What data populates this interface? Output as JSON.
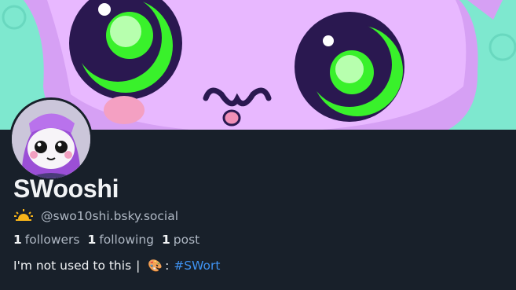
{
  "profile": {
    "display_name": "SWooshi",
    "handle_icon": "sunrise-icon",
    "handle": "@swo10shi.bsky.social",
    "stats": {
      "followers_count": "1",
      "followers_label": "followers",
      "following_count": "1",
      "following_label": "following",
      "posts_count": "1",
      "posts_label": "post"
    },
    "bio": {
      "text": "I'm not used to this",
      "separator": "|",
      "emoji": "🎨",
      "colon": ":",
      "hashtag": "#SWort"
    }
  },
  "colors": {
    "background": "#18202a",
    "banner_mint": "#7ee8cf",
    "banner_purple": "#c679ee",
    "eye_green": "#39f12b",
    "eye_navy": "#2a1850",
    "link": "#3f92f0",
    "muted_text": "#aeb7c3"
  }
}
